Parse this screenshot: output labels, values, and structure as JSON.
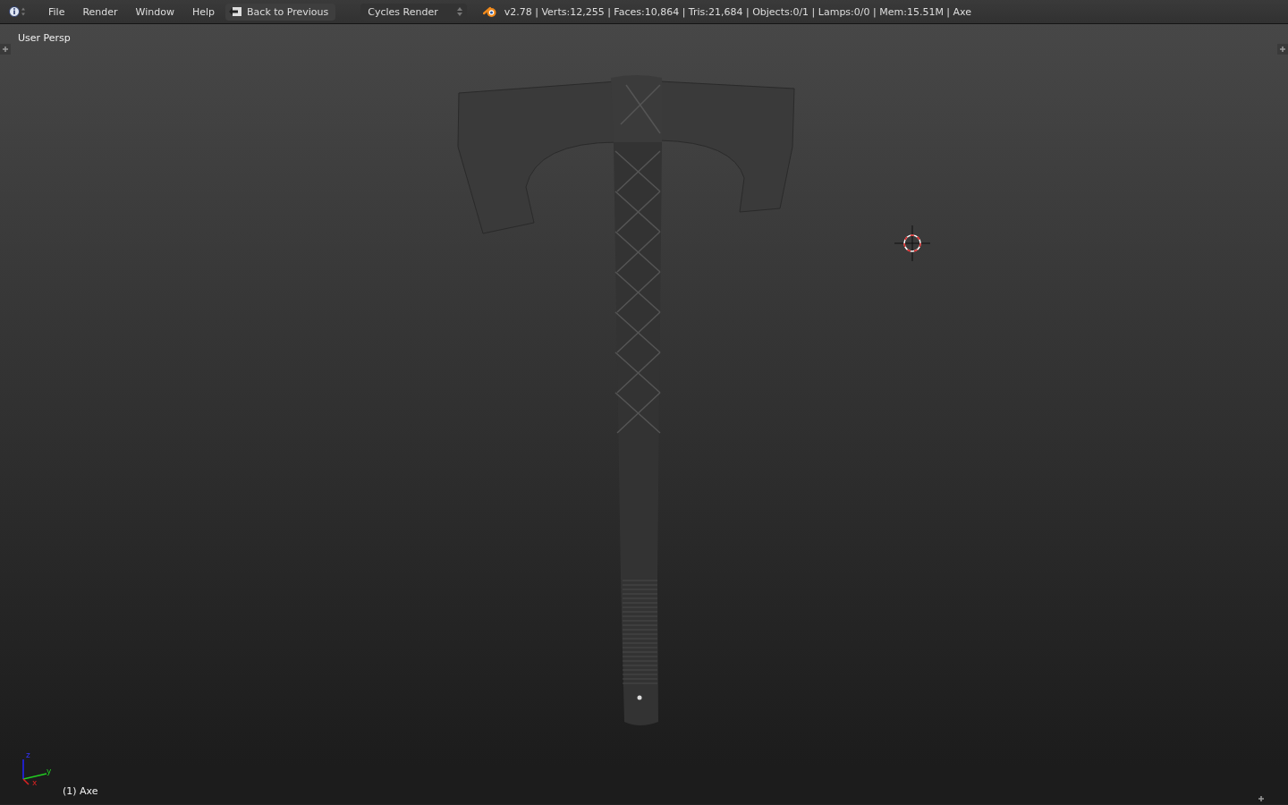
{
  "header": {
    "menus": [
      "File",
      "Render",
      "Window",
      "Help"
    ],
    "back_button": {
      "label": "Back to Previous"
    },
    "render_engine": {
      "value": "Cycles Render"
    },
    "stats": "v2.78 | Verts:12,255 | Faces:10,864 | Tris:21,684 | Objects:0/1 | Lamps:0/0 | Mem:15.51M | Axe"
  },
  "viewport": {
    "view_label": "User Persp",
    "object_label": "(1) Axe",
    "axis_labels": [
      "z",
      "y",
      "x"
    ]
  }
}
